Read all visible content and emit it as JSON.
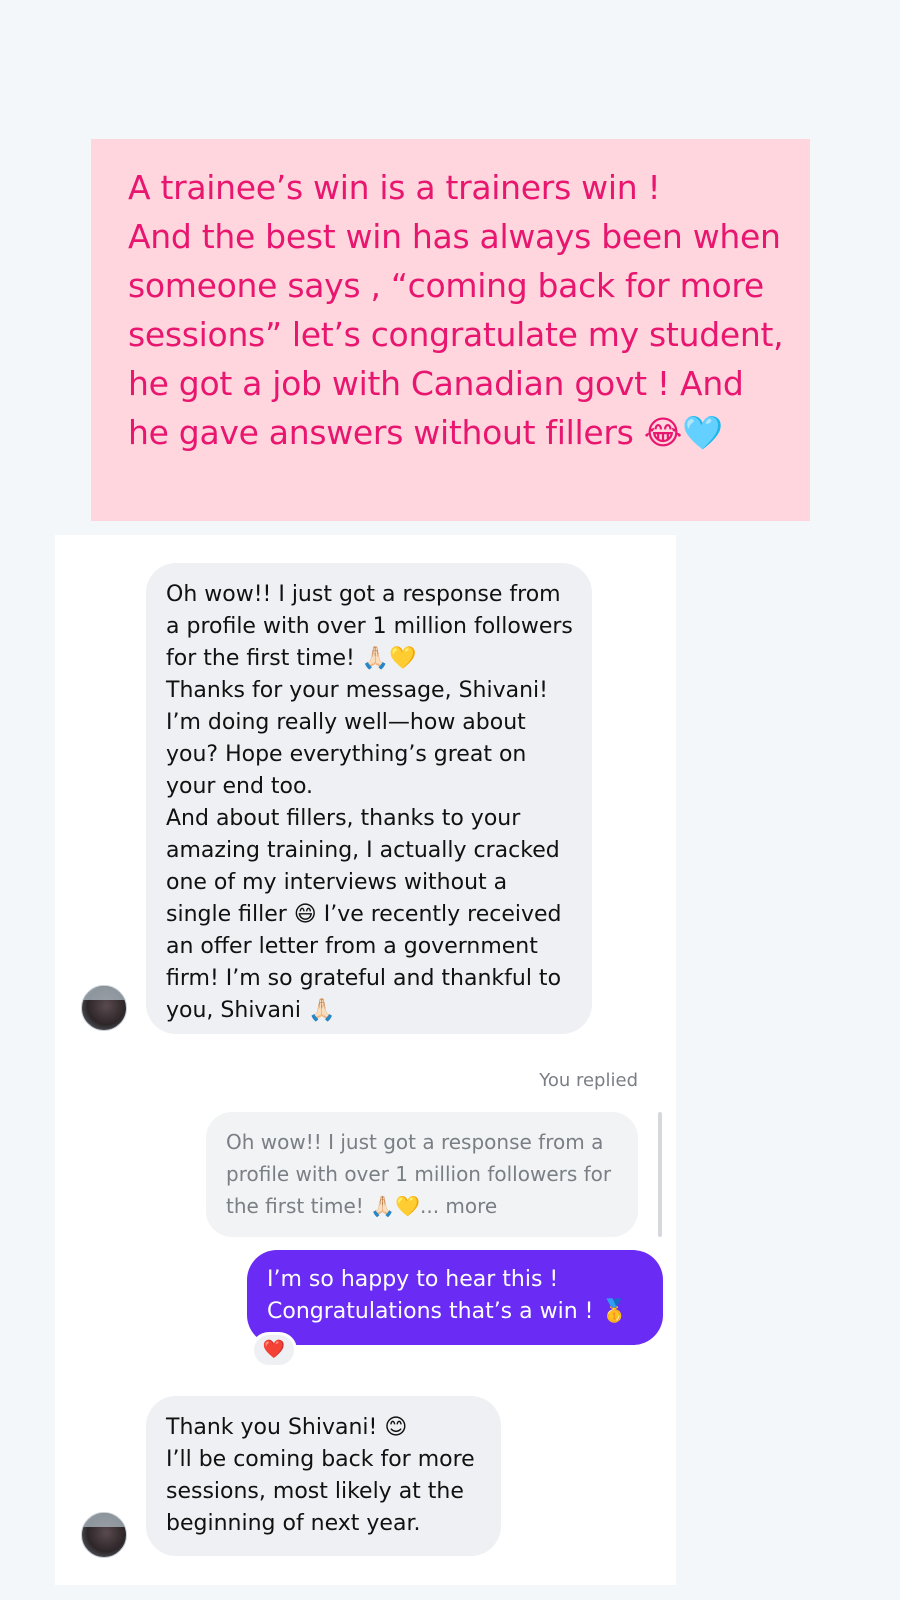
{
  "caption": {
    "text": "A trainee’s win is a trainers win !\nAnd the best win has always been when someone says , “coming back for more sessions” let’s congratulate my student, he  got a job with Canadian govt ! And he gave answers without fillers 😂🩵"
  },
  "chat": {
    "incoming_messages": [
      {
        "text": "Oh wow!! I just got a response from a profile with over 1 million followers for the first time! 🙏🏻💛\nThanks for your message, Shivani! I’m doing really well—how about you? Hope everything’s great on your end too.\nAnd about fillers, thanks to your amazing training, I actually cracked one of my interviews without a single filler 😄 I’ve recently received an offer letter from a government firm! I’m so grateful and thankful to you, Shivani 🙏🏻"
      },
      {
        "text": "Thank you Shivani! 😊\nI’ll be coming back for more sessions, most likely at the beginning of next year."
      }
    ],
    "reply_status": "You replied",
    "quoted_reply": {
      "text": "Oh wow!! I just got a response from a profile with over 1 million followers for the first time! 🙏🏻💛... more"
    },
    "outgoing_message": {
      "text": "I’m so happy to hear this !\nCongratulations that’s a win ! 🥇"
    },
    "reaction": "❤️",
    "colors": {
      "incoming_bubble": "#eef0f3",
      "outgoing_bubble": "#6a2bf5",
      "caption_background": "#ffd6de",
      "caption_text": "#e8166f"
    }
  }
}
